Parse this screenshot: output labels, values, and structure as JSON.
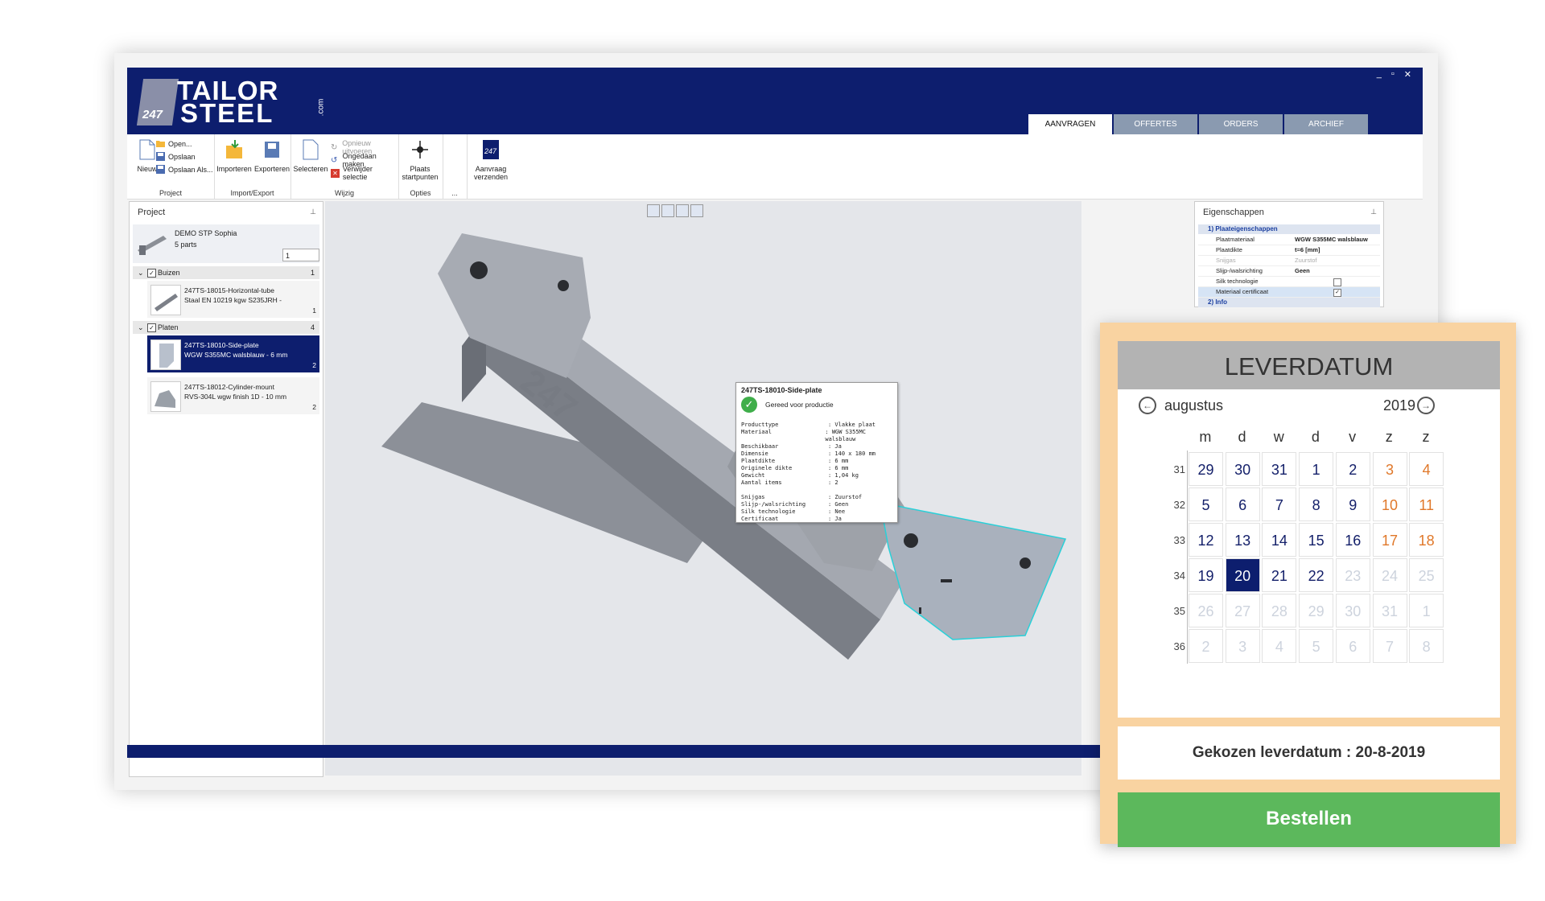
{
  "app": {
    "logo_prefix": "247",
    "logo_line1": "TAILOR",
    "logo_line2": "STEEL",
    "logo_suffix": ".com",
    "window_controls": [
      "_",
      "▫",
      "✕"
    ],
    "tabs": [
      "AANVRAGEN",
      "OFFERTES",
      "ORDERS",
      "ARCHIEF"
    ]
  },
  "ribbon": {
    "nieuw": "Nieuw",
    "open": "Open...",
    "opslaan": "Opslaan",
    "opslaan_als": "Opslaan Als...",
    "project_group": "Project",
    "importeren": "Importeren",
    "exporteren": "Exporteren",
    "import_export_group": "Import/Export",
    "selecteren": "Selecteren",
    "opnieuw": "Opnieuw uitvoeren",
    "ongedaan": "Ongedaan maken",
    "verwijder": "Verwijder selectie",
    "wijzig_group": "Wijzig",
    "plaats": "Plaats",
    "startpunten": "startpunten",
    "opties_group": "Opties",
    "more_group": "...",
    "aanvraag": "Aanvraag",
    "verzenden": "verzenden"
  },
  "project_panel": {
    "title": "Project",
    "project_name": "DEMO STP Sophia",
    "parts": "5 parts",
    "quantity": "1",
    "groups": [
      {
        "label": "Buizen",
        "count": "1",
        "parts": [
          {
            "line1": "247TS-18015-Horizontal-tube",
            "line2": "Staal EN 10219 kgw S235JRH -",
            "qty": "1"
          }
        ]
      },
      {
        "label": "Platen",
        "count": "4",
        "parts": [
          {
            "line1": "247TS-18010-Side-plate",
            "line2": "WGW S355MC walsblauw - 6 mm",
            "qty": "2"
          },
          {
            "line1": "247TS-18012-Cylinder-mount",
            "line2": "RVS-304L wgw finish 1D - 10 mm",
            "qty": "2"
          }
        ]
      }
    ]
  },
  "tooltip": {
    "title": "247TS-18010-Side-plate",
    "status": "Gereed voor productie",
    "rows1": [
      [
        "Producttype",
        ": Vlakke plaat"
      ],
      [
        "Materiaal",
        ": WGW S355MC walsblauw"
      ],
      [
        "Beschikbaar",
        ": Ja"
      ],
      [
        "Dimensie",
        ": 140 x 180 mm"
      ],
      [
        "Plaatdikte",
        ": 6 mm"
      ],
      [
        "Originele dikte",
        ": 6 mm"
      ],
      [
        "Gewicht",
        ": 1,04 kg"
      ],
      [
        "Aantal items",
        ": 2"
      ]
    ],
    "rows2": [
      [
        "Snijgas",
        ": Zuurstof"
      ],
      [
        "Slijp-/walsrichting",
        ": Geen"
      ],
      [
        "Silk technologie",
        ": Nee"
      ],
      [
        "Certificaat",
        ": Ja"
      ]
    ]
  },
  "model_embossing": "247",
  "properties": {
    "title": "Eigenschappen",
    "section1": "1) Plaateigenschappen",
    "rows": [
      {
        "label": "Plaatmateriaal",
        "value": "WGW S355MC walsblauw"
      },
      {
        "label": "Plaatdikte",
        "value": "t=6 [mm]"
      },
      {
        "label": "Snijgas",
        "value": "Zuurstof"
      },
      {
        "label": "Slijp-/walsrichting",
        "value": "Geen"
      },
      {
        "label": "Silk technologie",
        "value": ""
      },
      {
        "label": "Materiaal certificaat",
        "value": "✓"
      }
    ],
    "section2": "2) Info"
  },
  "calendar": {
    "title": "LEVERDATUM",
    "month": "augustus",
    "year": "2019",
    "prev_icon": "arrow-left-icon",
    "next_icon": "arrow-right-icon",
    "weekdays": [
      "m",
      "d",
      "w",
      "d",
      "v",
      "z",
      "z"
    ],
    "weeks": [
      {
        "week": "31",
        "days": [
          "29",
          "30",
          "31",
          "1",
          "2",
          "3",
          "4"
        ],
        "state": [
          "cur",
          "cur",
          "cur",
          "cur",
          "cur",
          "we",
          "we"
        ]
      },
      {
        "week": "32",
        "days": [
          "5",
          "6",
          "7",
          "8",
          "9",
          "10",
          "11"
        ],
        "state": [
          "cur",
          "cur",
          "cur",
          "cur",
          "cur",
          "we",
          "we"
        ]
      },
      {
        "week": "33",
        "days": [
          "12",
          "13",
          "14",
          "15",
          "16",
          "17",
          "18"
        ],
        "state": [
          "cur",
          "cur",
          "cur",
          "cur",
          "cur",
          "we",
          "we"
        ]
      },
      {
        "week": "34",
        "days": [
          "19",
          "20",
          "21",
          "22",
          "23",
          "24",
          "25"
        ],
        "state": [
          "cur",
          "sel",
          "cur",
          "cur",
          "dim",
          "dim",
          "dim"
        ]
      },
      {
        "week": "35",
        "days": [
          "26",
          "27",
          "28",
          "29",
          "30",
          "31",
          "1"
        ],
        "state": [
          "dim",
          "dim",
          "dim",
          "dim",
          "dim",
          "dim",
          "dim"
        ]
      },
      {
        "week": "36",
        "days": [
          "2",
          "3",
          "4",
          "5",
          "6",
          "7",
          "8"
        ],
        "state": [
          "dim",
          "dim",
          "dim",
          "dim",
          "dim",
          "dim",
          "dim"
        ]
      }
    ],
    "chosen": "Gekozen leverdatum : 20-8-2019",
    "order_button": "Bestellen"
  },
  "colors": {
    "navy": "#0d1e6e",
    "weekend": "#e0782a",
    "order_green": "#5cb85c",
    "calendar_frame": "#f9d3a1"
  }
}
